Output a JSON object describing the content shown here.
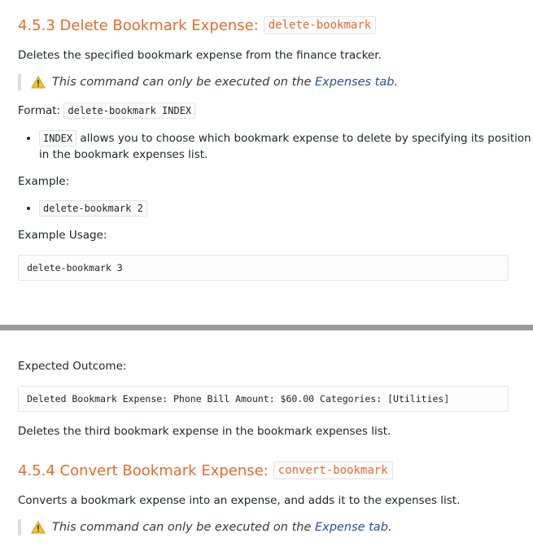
{
  "section_453": {
    "number_title": "4.5.3 Delete Bookmark Expense:",
    "command": "delete-bookmark",
    "description": "Deletes the specified bookmark expense from the finance tracker.",
    "note_prefix": "This command can only be executed on the ",
    "note_link": "Expenses tab",
    "note_suffix": ".",
    "format_label": "Format:",
    "format_code": "delete-bookmark INDEX",
    "bullet_code": "INDEX",
    "bullet_text": " allows you to choose which bookmark expense to delete by specifying its position in the bookmark expenses list.",
    "example_label": "Example:",
    "example_code": "delete-bookmark 2",
    "usage_label": "Example Usage:",
    "usage_code": "delete-bookmark 3",
    "outcome_label": "Expected Outcome:",
    "outcome_code": "Deleted Bookmark Expense: Phone Bill Amount: $60.00 Categories: [Utilities]",
    "outcome_text": "Deletes the third bookmark expense in the bookmark expenses list."
  },
  "section_454": {
    "number_title": "4.5.4 Convert Bookmark Expense:",
    "command": "convert-bookmark",
    "description": "Converts a bookmark expense into an expense, and adds it to the expenses list.",
    "note_prefix": "This command can only be executed on the ",
    "note_link": "Expense tab",
    "note_suffix": "."
  },
  "icons": {
    "warning": "warning-icon"
  },
  "colors": {
    "heading": "#e36c2b",
    "link": "#2c4f94",
    "divider": "#999999"
  }
}
